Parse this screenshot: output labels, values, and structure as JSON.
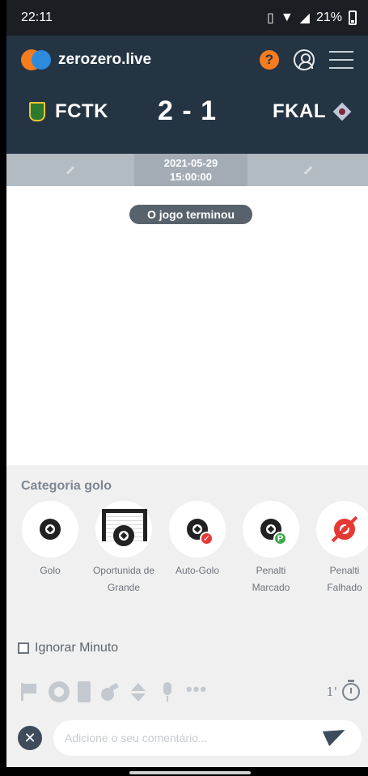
{
  "status_bar": {
    "time": "22:11",
    "battery": "21%"
  },
  "app": {
    "name": "zerozero.live",
    "help_icon": "help-icon",
    "colors": {
      "header": "#243443",
      "accent": "#f57c1f"
    }
  },
  "match": {
    "home": "FCTK",
    "away": "FKAL",
    "score": "2 - 1",
    "date": "2021-05-29",
    "time": "15:00:00",
    "status": "O jogo terminou"
  },
  "panel": {
    "category_title": "Categoria golo",
    "categories": [
      {
        "label": "Golo",
        "icon": "soccer-ball-icon"
      },
      {
        "label": "Oportunida de Grande",
        "icon": "goal-net-icon"
      },
      {
        "label": "Auto-Golo",
        "icon": "own-goal-icon"
      },
      {
        "label": "Penalti Marcado",
        "icon": "penalty-scored-icon"
      },
      {
        "label": "Penalti Falhado",
        "icon": "penalty-missed-icon"
      }
    ],
    "ignore_minute": "Ignorar Minuto",
    "minute": "1'",
    "comment_placeholder": "Adicione o seu comentário..."
  }
}
